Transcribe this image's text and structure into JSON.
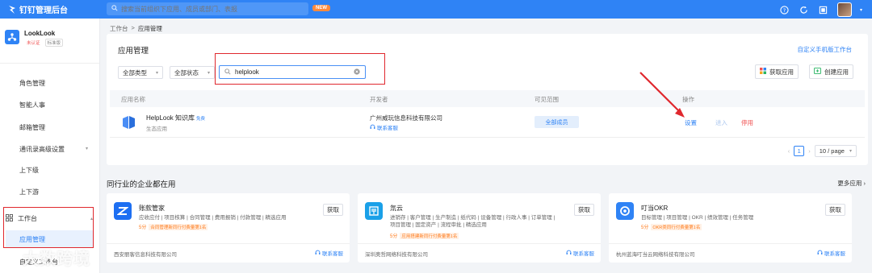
{
  "topbar": {
    "brand": "钉钉管理后台",
    "search_placeholder": "搜索当前组织下应用、成员或部门、表报",
    "new_badge": "NEW",
    "icons": [
      "help-icon",
      "refresh-icon",
      "fullscreen-icon",
      "avatar"
    ]
  },
  "sidebar": {
    "org_name": "LookLook",
    "org_tag_unverified": "未认证",
    "org_tag_edition": "标准版",
    "items": [
      "角色管理",
      "智能人事",
      "邮箱管理",
      "通讯录高级设置",
      "上下级",
      "上下游"
    ],
    "group_label": "工作台",
    "active_item": "应用管理",
    "next_item": "自定义工作台"
  },
  "breadcrumb": {
    "root": "工作台",
    "sep": ">",
    "current": "应用管理"
  },
  "app_card": {
    "title": "应用管理",
    "custom_link": "自定义手机版工作台",
    "filter_type": "全部类型",
    "filter_status": "全部状态",
    "search_value": "helplook",
    "btn_get": "获取应用",
    "btn_create": "创建应用",
    "columns": [
      "应用名称",
      "开发者",
      "可见范围",
      "操作"
    ],
    "row": {
      "name": "HelpLook 知识库",
      "free_tag": "免费",
      "type": "生态应用",
      "developer": "广州威玩信息科技有限公司",
      "contact": "联系客服",
      "scope": "全部成员",
      "action_settings": "设置",
      "action_enter": "进入",
      "action_disable": "停用"
    },
    "pager": {
      "page": "1",
      "size": "10 / page"
    }
  },
  "peers": {
    "title": "同行业的企业都在用",
    "more": "更多应用",
    "cards": [
      {
        "name": "账款管家",
        "desc": "应收应付 | 项目核算 | 合同管理 | 费用报销 | 付款管理 | 精选应用",
        "score": "5分",
        "rank": "合同管理新同行付费量第1名",
        "get": "获取",
        "vendor": "西安丽客信息科技有限公司",
        "service": "联系客服",
        "color": "#1d6ff2"
      },
      {
        "name": "氚云",
        "desc": "进销存 | 客户管理 | 生产制造 | 纸代码 | 设备管理 | 行政人事 | 订单管理 | 项目管理 | 固定资产 | 流程审批 | 精选应用",
        "score": "5分",
        "rank": "应用搭建新同行付费量第1名",
        "get": "获取",
        "vendor": "深圳奥哲网络科技有限公司",
        "service": "联系客服",
        "color": "#1aa0e8"
      },
      {
        "name": "叮当OKR",
        "desc": "目标管理 | 项目管理 | OKR | 绩效管理 | 任务管理",
        "score": "5分",
        "rank": "OKR类同行付费量第1名",
        "get": "获取",
        "vendor": "杭州蓝海叮当云网络科技有限公司",
        "service": "联系客服",
        "color": "#2f83f5"
      }
    ]
  },
  "watermark": "大数跨境"
}
